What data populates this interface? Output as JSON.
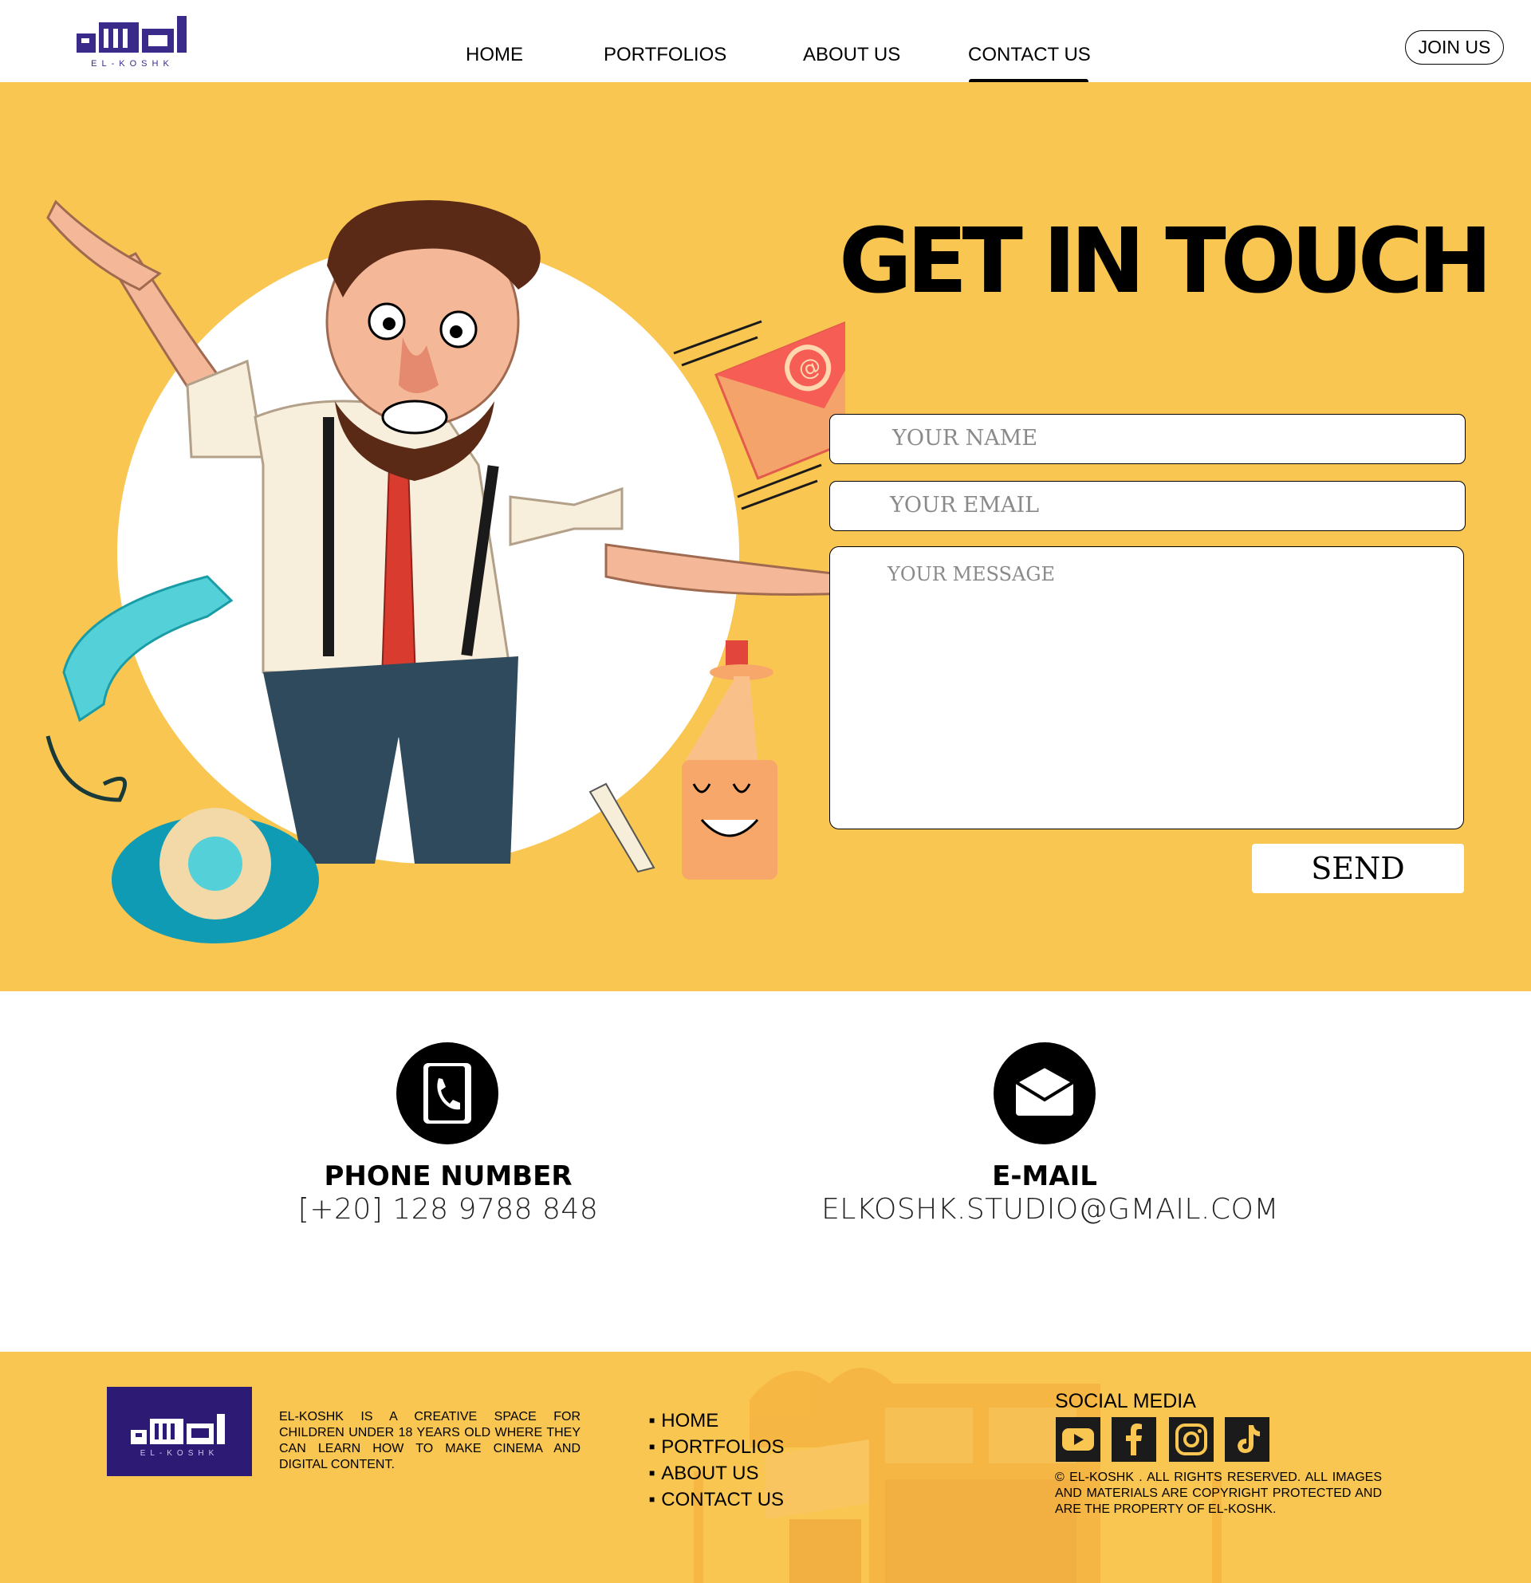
{
  "header": {
    "logo_text": "EL-KOSHK",
    "nav": [
      {
        "label": "HOME"
      },
      {
        "label": "PORTFOLIOS"
      },
      {
        "label": "ABOUT US"
      },
      {
        "label": "CONTACT US",
        "active": true
      }
    ],
    "join_label": "JOIN US"
  },
  "hero": {
    "title": "GET IN TOUCH",
    "name_placeholder": "YOUR NAME",
    "email_placeholder": "YOUR EMAIL",
    "message_placeholder": "YOUR MESSAGE",
    "send_label": "SEND"
  },
  "contact": {
    "phone_label": "PHONE NUMBER",
    "phone_value": "[+20] 128 9788 848",
    "email_label": "E-MAIL",
    "email_value": "ELKOSHK.STUDIO@GMAIL.COM"
  },
  "footer": {
    "logo_text": "EL-KOSHK",
    "about": "EL-KOSHK IS A CREATIVE SPACE FOR CHILDREN UNDER 18 YEARS OLD WHERE THEY CAN LEARN HOW TO MAKE CINEMA AND DIGITAL CONTENT.",
    "links": [
      "HOME",
      "PORTFOLIOS",
      "ABOUT US",
      "CONTACT US"
    ],
    "social_title": "SOCIAL MEDIA",
    "social_icons": [
      "youtube-icon",
      "facebook-icon",
      "instagram-icon",
      "tiktok-icon"
    ],
    "copyright": "© EL-KOSHK . ALL RIGHTS RESERVED. ALL IMAGES AND MATERIALS ARE COPYRIGHT PROTECTED AND ARE THE PROPERTY OF EL-KOSHK."
  },
  "colors": {
    "accent_yellow": "#f9c651",
    "logo_purple": "#2c1a75",
    "text": "#000000"
  }
}
